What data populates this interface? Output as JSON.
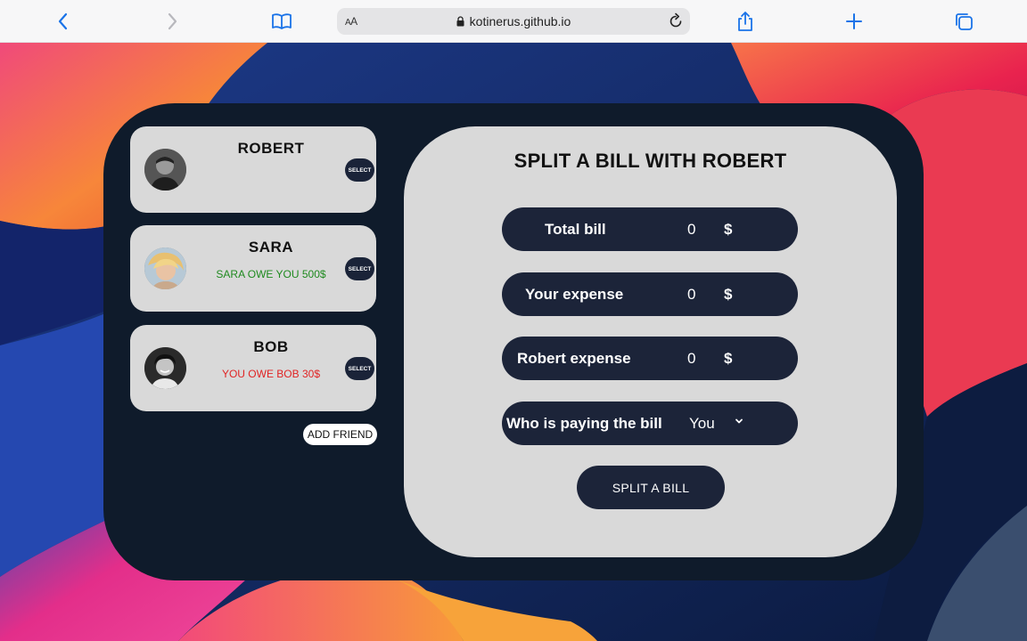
{
  "browser": {
    "text_size_label_big": "A",
    "text_size_label_small": "A",
    "url": "kotinerus.github.io"
  },
  "friends": [
    {
      "name": "ROBERT",
      "status": "",
      "status_color": "#111111",
      "select_label": "SELECT"
    },
    {
      "name": "SARA",
      "status": "SARA OWE YOU 500$",
      "status_color": "#1f8a1f",
      "select_label": "SELECT"
    },
    {
      "name": "BOB",
      "status": "YOU OWE BOB 30$",
      "status_color": "#e02424",
      "select_label": "SELECT"
    }
  ],
  "add_friend_label": "ADD FRIEND",
  "split_form": {
    "title": "SPLIT A BILL WITH ROBERT",
    "total_bill": {
      "label": "Total bill",
      "value": "0",
      "currency": "$"
    },
    "your_expense": {
      "label": "Your expense",
      "value": "0",
      "currency": "$"
    },
    "friend_expense": {
      "label": "Robert expense",
      "value": "0",
      "currency": "$"
    },
    "payer": {
      "label": "Who is paying the bill",
      "selected": "You"
    },
    "submit_label": "SPLIT A BILL"
  },
  "colors": {
    "app_bg": "#0f1b2b",
    "panel_bg": "#d9d9d9",
    "row_bg": "#1c2439",
    "accent_blue": "#1a73e8"
  },
  "icons": {
    "back": "chevron-left-icon",
    "forward": "chevron-right-icon",
    "reader": "book-icon",
    "lock": "lock-icon",
    "reload": "reload-icon",
    "share": "share-icon",
    "new_tab": "plus-icon",
    "tabs": "tabs-icon"
  }
}
